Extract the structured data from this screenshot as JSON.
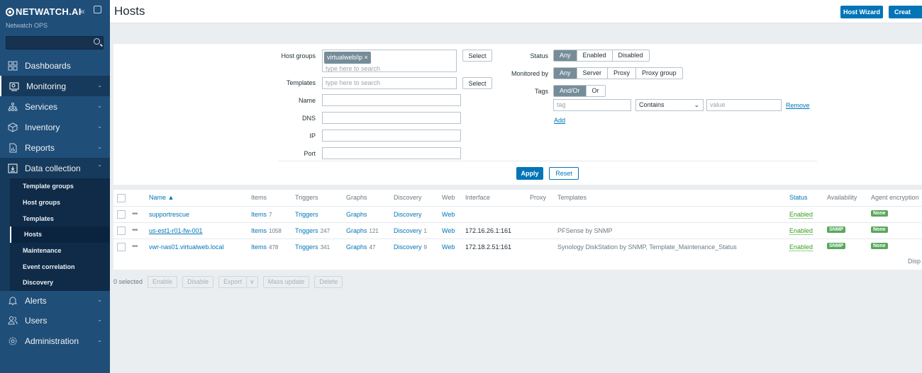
{
  "sidebar": {
    "brand": "NETWATCH.AI",
    "subtitle": "Netwatch OPS",
    "collapse": "«",
    "nav": [
      {
        "label": "Dashboards"
      },
      {
        "label": "Monitoring"
      },
      {
        "label": "Services"
      },
      {
        "label": "Inventory"
      },
      {
        "label": "Reports"
      },
      {
        "label": "Data collection"
      },
      {
        "label": "Alerts"
      },
      {
        "label": "Users"
      },
      {
        "label": "Administration"
      }
    ],
    "submenu": [
      "Template groups",
      "Host groups",
      "Templates",
      "Hosts",
      "Maintenance",
      "Event correlation",
      "Discovery"
    ]
  },
  "header": {
    "title": "Hosts",
    "host_wizard": "Host Wizard",
    "create": "Creat"
  },
  "filter": {
    "host_groups_label": "Host groups",
    "host_group_chip": "virtualweb/ip",
    "chip_remove": "×",
    "search_placeholder": "type here to search",
    "select_label": "Select",
    "templates_label": "Templates",
    "name_label": "Name",
    "dns_label": "DNS",
    "ip_label": "IP",
    "port_label": "Port",
    "status_label": "Status",
    "status_options": [
      "Any",
      "Enabled",
      "Disabled"
    ],
    "monitored_by_label": "Monitored by",
    "monitored_options": [
      "Any",
      "Server",
      "Proxy",
      "Proxy group"
    ],
    "tags_label": "Tags",
    "tags_options": [
      "And/Or",
      "Or"
    ],
    "tag_placeholder": "tag",
    "operator": "Contains",
    "value_placeholder": "value",
    "remove": "Remove",
    "add": "Add",
    "apply": "Apply",
    "reset": "Reset"
  },
  "table": {
    "headers": {
      "name": "Name ▲",
      "items": "Items",
      "triggers": "Triggers",
      "graphs": "Graphs",
      "discovery": "Discovery",
      "web": "Web",
      "interface": "Interface",
      "proxy": "Proxy",
      "templates": "Templates",
      "status": "Status",
      "availability": "Availability",
      "agent_encryption": "Agent encryption"
    },
    "rows": [
      {
        "name": "supportrescue",
        "items": "Items",
        "items_count": "7",
        "triggers": "Triggers",
        "triggers_count": "",
        "graphs": "Graphs",
        "graphs_count": "",
        "discovery": "Discovery",
        "discovery_count": "",
        "web": "Web",
        "interface": "",
        "templates": "",
        "status": "Enabled",
        "availability": "",
        "encryption": "None"
      },
      {
        "name": "us-est1-r01-fw-001",
        "items": "Items",
        "items_count": "1058",
        "triggers": "Triggers",
        "triggers_count": "247",
        "graphs": "Graphs",
        "graphs_count": "121",
        "discovery": "Discovery",
        "discovery_count": "1",
        "web": "Web",
        "interface": "172.16.26.1:161",
        "templates": "PFSense by SNMP",
        "status": "Enabled",
        "availability": "SNMP",
        "encryption": "None"
      },
      {
        "name": "vwr-nas01.virtualweb.local",
        "items": "Items",
        "items_count": "478",
        "triggers": "Triggers",
        "triggers_count": "341",
        "graphs": "Graphs",
        "graphs_count": "47",
        "discovery": "Discovery",
        "discovery_count": "9",
        "web": "Web",
        "interface": "172.18.2.51:161",
        "templates": "Synology DiskStation by SNMP, Template_Maintenance_Status",
        "status": "Enabled",
        "availability": "SNMP",
        "encryption": "None"
      }
    ],
    "displaying": "Disp"
  },
  "mass": {
    "selected": "0 selected",
    "enable": "Enable",
    "disable": "Disable",
    "export": "Export",
    "export_menu": "∨",
    "mass_update": "Mass update",
    "delete": "Delete"
  },
  "colors": {
    "sidebar": "#1f4e79",
    "accent": "#0275b8",
    "enabled": "#34a01d",
    "tag": "#59a75d"
  }
}
